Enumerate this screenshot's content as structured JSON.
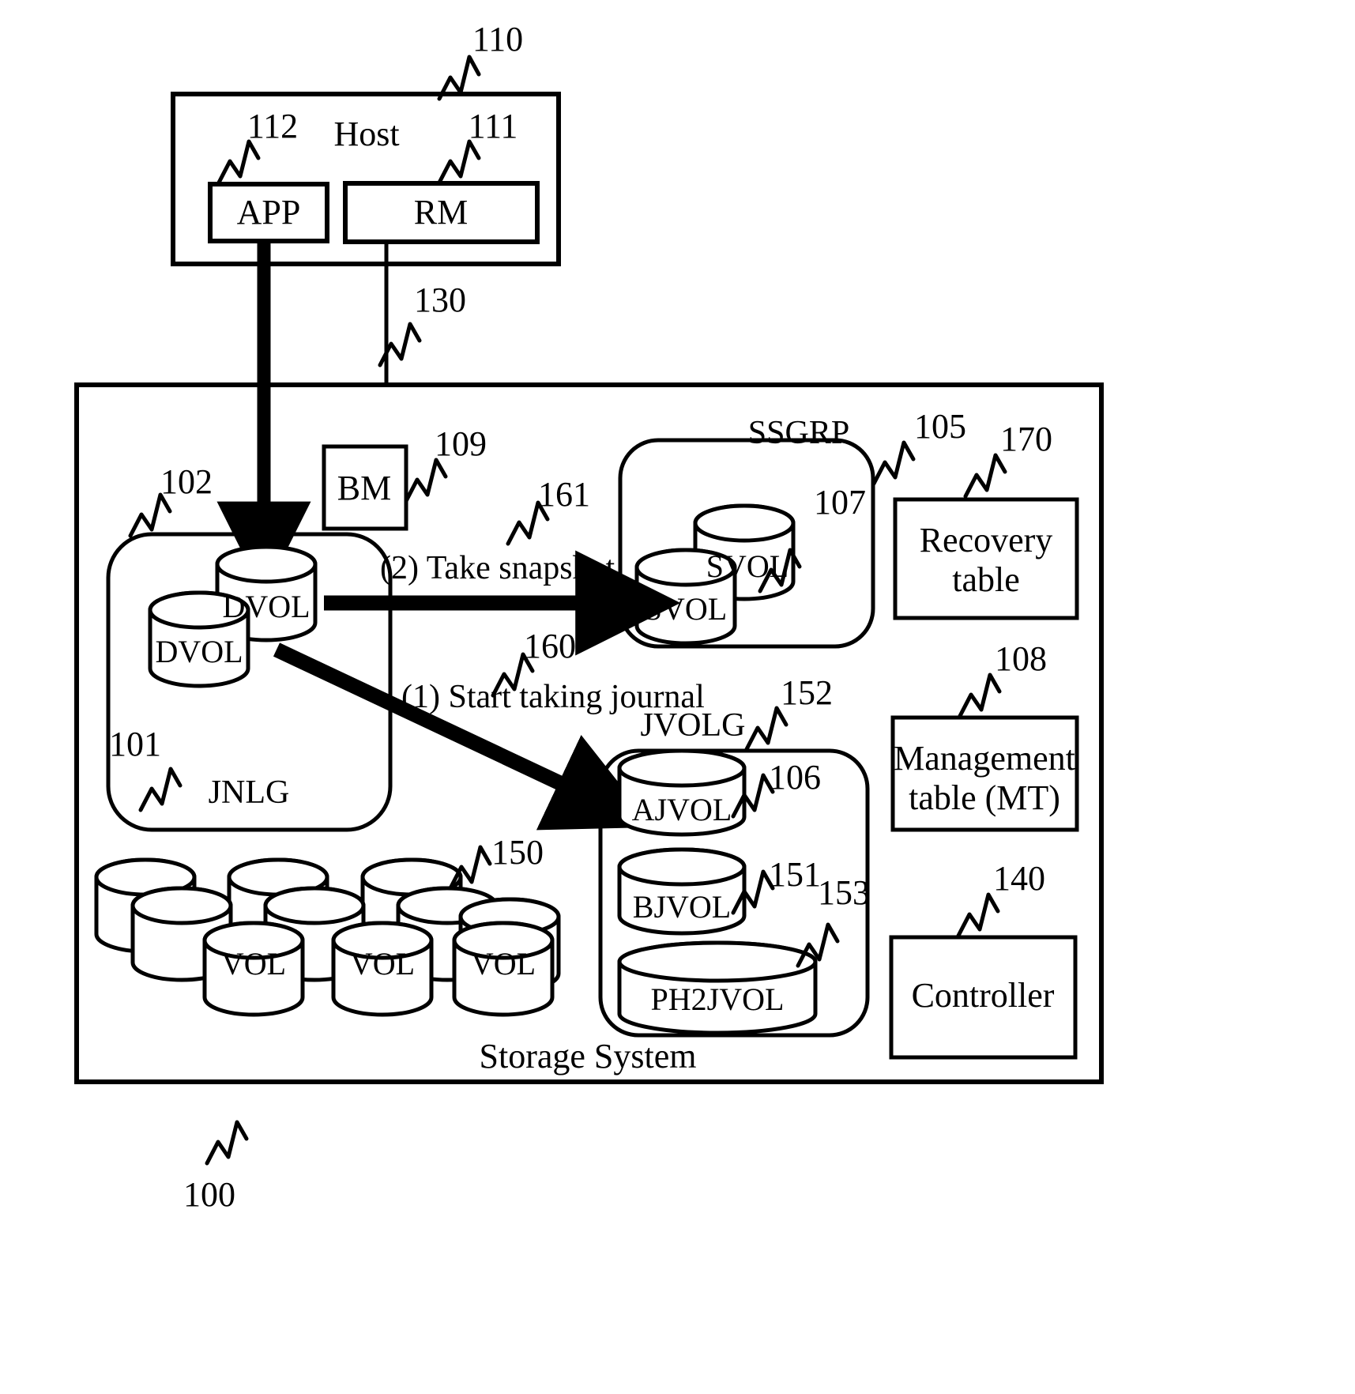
{
  "figure": {
    "type": "patent-block-diagram",
    "title_text": ""
  },
  "host": {
    "label": "Host",
    "ref": "110",
    "app": {
      "label": "APP",
      "ref": "112"
    },
    "rm": {
      "label": "RM",
      "ref": "111"
    }
  },
  "link": {
    "ref": "130"
  },
  "storage": {
    "label": "Storage System",
    "ref": "100",
    "bm": {
      "label": "BM",
      "ref": "109"
    },
    "jnlg": {
      "label": "JNLG",
      "ref_group": "102",
      "ref_vol": "101",
      "dvol_front": "DVOL",
      "dvol_back": "DVOL"
    },
    "ssgrp": {
      "label": "SSGRP",
      "ref": "105",
      "svol_ref": "107",
      "svol_back": "SVOL",
      "svol_front": "SVOL"
    },
    "jvolg": {
      "label": "JVOLG",
      "ref": "152",
      "ajvol": {
        "label": "AJVOL",
        "ref": "106"
      },
      "bjvol": {
        "label": "BJVOL",
        "ref": "151"
      },
      "ph2jvol": {
        "label": "PH2JVOL",
        "ref": "153"
      }
    },
    "volpool": {
      "ref": "150",
      "vol_labels": [
        "VOL",
        "VOL",
        "VOL"
      ]
    },
    "recovery_table": {
      "label_line1": "Recovery",
      "label_line2": "table",
      "ref": "170"
    },
    "management_table": {
      "label_line1": "Management",
      "label_line2": "table (MT)",
      "ref": "108"
    },
    "controller": {
      "label": "Controller",
      "ref": "140"
    }
  },
  "steps": {
    "step1": {
      "text": "(1) Start taking journal",
      "ref": "160"
    },
    "step2": {
      "text": "(2) Take snapshot",
      "ref": "161"
    }
  }
}
